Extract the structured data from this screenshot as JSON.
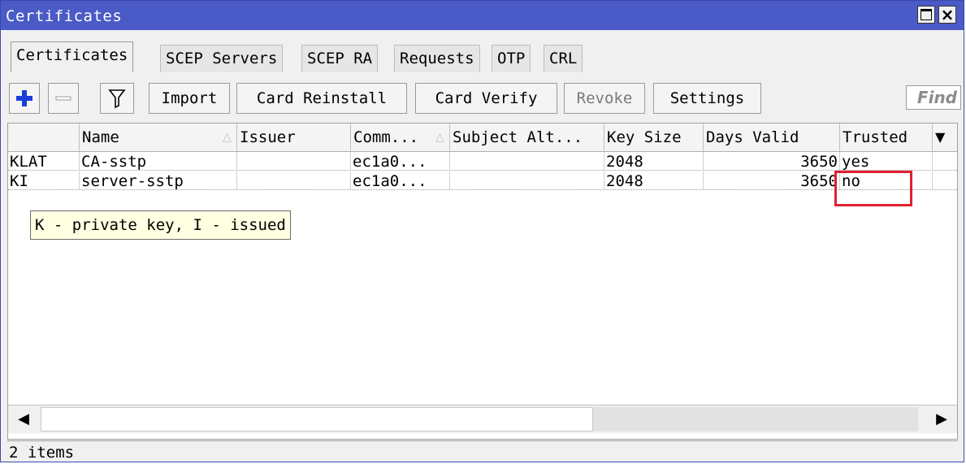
{
  "window": {
    "title": "Certificates"
  },
  "tabs": [
    {
      "label": "Certificates"
    },
    {
      "label": "SCEP Servers"
    },
    {
      "label": "SCEP RA"
    },
    {
      "label": "Requests"
    },
    {
      "label": "OTP"
    },
    {
      "label": "CRL"
    }
  ],
  "toolbar": {
    "add_icon": "plus-icon",
    "remove_icon": "minus-icon",
    "filter_icon": "funnel-icon",
    "import_label": "Import",
    "card_reinstall_label": "Card Reinstall",
    "card_verify_label": "Card Verify",
    "revoke_label": "Revoke",
    "settings_label": "Settings",
    "find_placeholder": "Find"
  },
  "table": {
    "columns": [
      "",
      "Name",
      "Issuer",
      "Comm...",
      "Subject Alt...",
      "Key Size",
      "Days Valid",
      "Trusted"
    ],
    "rows": [
      {
        "flags": "KLAT",
        "name": "CA-sstp",
        "issuer": "",
        "common": "ec1a0...",
        "subject_alt": "",
        "key_size": "2048",
        "days_valid": "3650",
        "trusted": "yes"
      },
      {
        "flags": "KI",
        "name": "server-sstp",
        "issuer": "",
        "common": "ec1a0...",
        "subject_alt": "",
        "key_size": "2048",
        "days_valid": "3650",
        "trusted": "no"
      }
    ],
    "tooltip": "K - private key, I - issued"
  },
  "status": {
    "count": "2 items"
  },
  "colors": {
    "titlebar": "#4a5ac6",
    "highlight": "#e02030",
    "tooltip_bg": "#ffffe1"
  }
}
